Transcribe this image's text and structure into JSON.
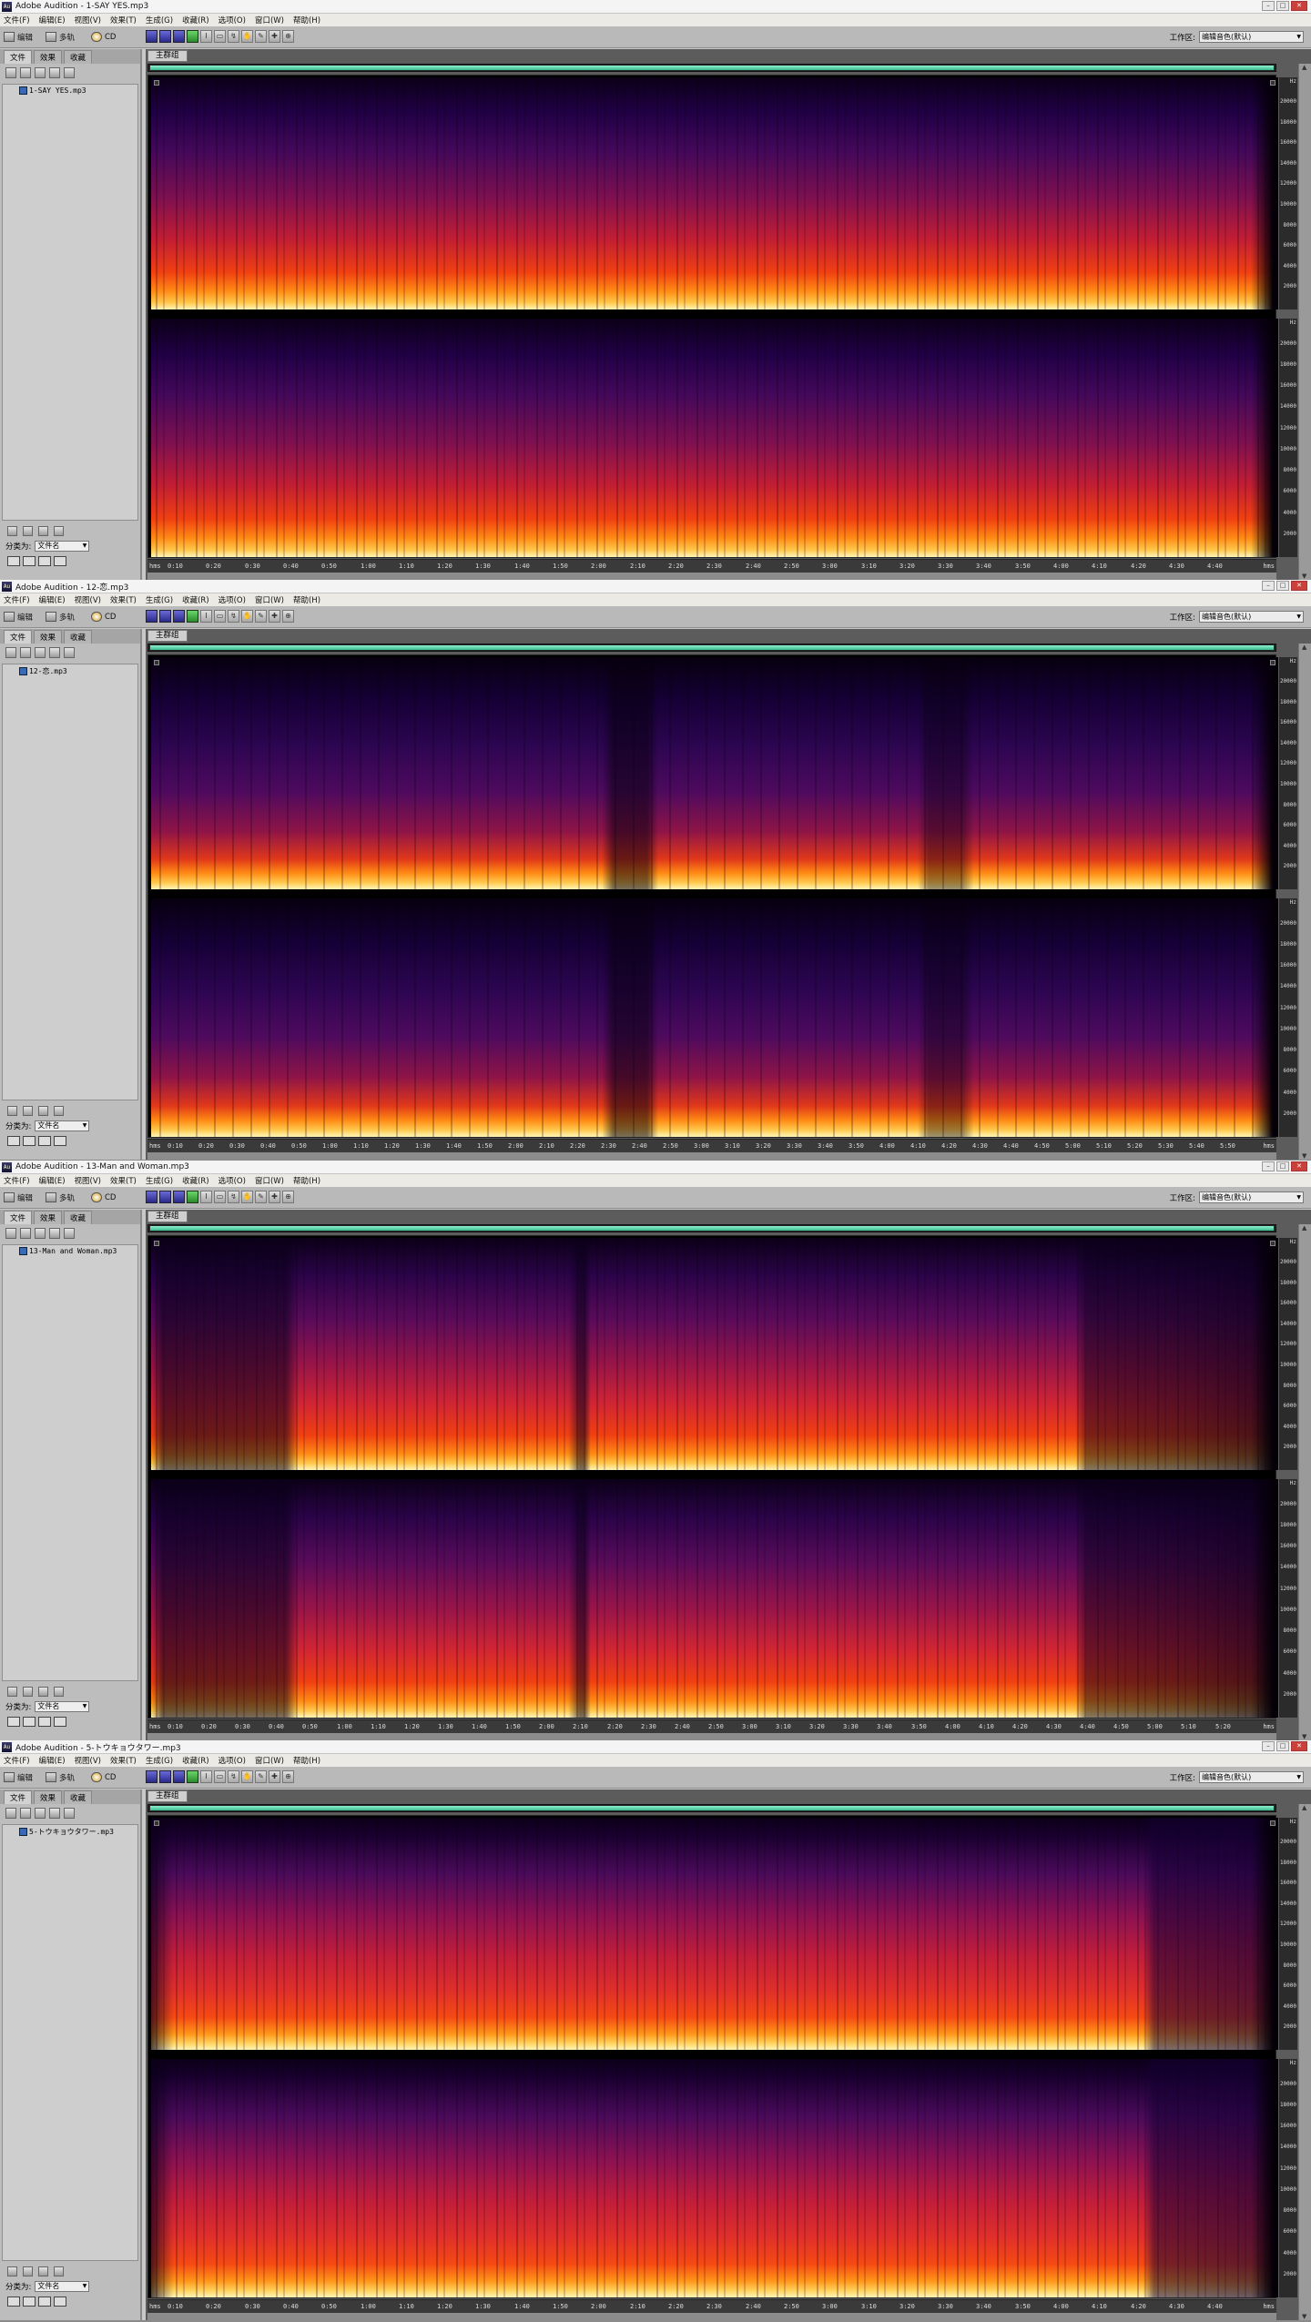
{
  "app_name": "Adobe Audition",
  "menus": [
    "文件(F)",
    "编辑(E)",
    "视图(V)",
    "效果(T)",
    "生成(G)",
    "收藏(R)",
    "选项(O)",
    "窗口(W)",
    "帮助(H)"
  ],
  "toolbar": {
    "edit_label": "编辑",
    "multitrack_label": "多轨",
    "cd_label": "CD",
    "workspace_label": "工作区:",
    "workspace_value": "编辑音色(默认)"
  },
  "left_tabs": [
    "文件",
    "效果",
    "收藏"
  ],
  "group_by_label": "分类为:",
  "group_by_value": "文件名",
  "main_tab": "主群组",
  "hz_label": "Hz",
  "hms_label": "hms",
  "freq_ticks": [
    "20000",
    "18000",
    "16000",
    "14000",
    "12000",
    "10000",
    "8000",
    "6000",
    "4000",
    "2000"
  ],
  "windows": [
    {
      "title": "Adobe Audition - 1-SAY YES.mp3",
      "file": "1-SAY YES.mp3",
      "times": [
        "0:10",
        "0:20",
        "0:30",
        "0:40",
        "0:50",
        "1:00",
        "1:10",
        "1:20",
        "1:30",
        "1:40",
        "1:50",
        "2:00",
        "2:10",
        "2:20",
        "2:30",
        "2:40",
        "2:50",
        "3:00",
        "3:10",
        "3:20",
        "3:30",
        "3:40",
        "3:50",
        "4:00",
        "4:10",
        "4:20",
        "4:30",
        "4:40"
      ]
    },
    {
      "title": "Adobe Audition - 12-恋.mp3",
      "file": "12-恋.mp3",
      "times": [
        "0:10",
        "0:20",
        "0:30",
        "0:40",
        "0:50",
        "1:00",
        "1:10",
        "1:20",
        "1:30",
        "1:40",
        "1:50",
        "2:00",
        "2:10",
        "2:20",
        "2:30",
        "2:40",
        "2:50",
        "3:00",
        "3:10",
        "3:20",
        "3:30",
        "3:40",
        "3:50",
        "4:00",
        "4:10",
        "4:20",
        "4:30",
        "4:40",
        "4:50",
        "5:00",
        "5:10",
        "5:20",
        "5:30",
        "5:40",
        "5:50"
      ]
    },
    {
      "title": "Adobe Audition - 13-Man and Woman.mp3",
      "file": "13-Man and Woman.mp3",
      "times": [
        "0:10",
        "0:20",
        "0:30",
        "0:40",
        "0:50",
        "1:00",
        "1:10",
        "1:20",
        "1:30",
        "1:40",
        "1:50",
        "2:00",
        "2:10",
        "2:20",
        "2:30",
        "2:40",
        "2:50",
        "3:00",
        "3:10",
        "3:20",
        "3:30",
        "3:40",
        "3:50",
        "4:00",
        "4:10",
        "4:20",
        "4:30",
        "4:40",
        "4:50",
        "5:00",
        "5:10",
        "5:20"
      ]
    },
    {
      "title": "Adobe Audition - 5-トウキョウタワー.mp3",
      "file": "5-トウキョウタワー.mp3",
      "times": [
        "0:10",
        "0:20",
        "0:30",
        "0:40",
        "0:50",
        "1:00",
        "1:10",
        "1:20",
        "1:30",
        "1:40",
        "1:50",
        "2:00",
        "2:10",
        "2:20",
        "2:30",
        "2:40",
        "2:50",
        "3:00",
        "3:10",
        "3:20",
        "3:30",
        "3:40",
        "3:50",
        "4:00",
        "4:10",
        "4:20",
        "4:30",
        "4:40"
      ]
    }
  ]
}
